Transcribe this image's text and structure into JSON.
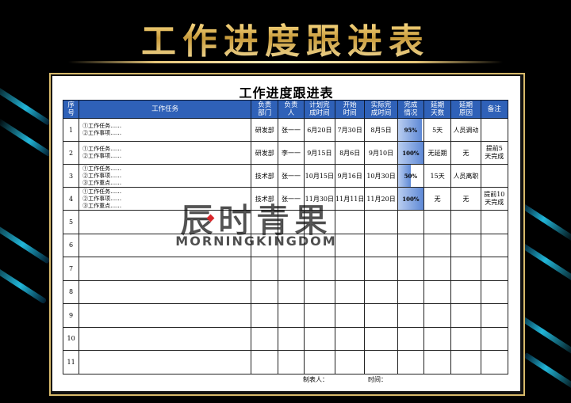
{
  "banner": {
    "title": "工作进度跟进表"
  },
  "sheet": {
    "title": "工作进度跟进表",
    "headers": {
      "no": [
        "序",
        "号"
      ],
      "task": "工作任务",
      "dept": [
        "负责",
        "部门"
      ],
      "person": [
        "负责",
        "人"
      ],
      "plan": [
        "计划完",
        "成时间"
      ],
      "start": [
        "开始",
        "时间"
      ],
      "actual": [
        "实际完",
        "成时间"
      ],
      "progress": [
        "完成",
        "情况"
      ],
      "delay_days": [
        "延期",
        "天数"
      ],
      "delay_reason": [
        "延期",
        "原因"
      ],
      "remark": "备注"
    },
    "rows": [
      {
        "no": "1",
        "tasks": [
          "①工作任务……",
          "②工作事项……"
        ],
        "dept": "研发部",
        "person": "张一一",
        "plan": "6月20日",
        "start": "7月30日",
        "actual": "8月5日",
        "progress": "95%",
        "progress_value": 0.95,
        "delay_days": "5天",
        "delay_reason": "人员调动",
        "remark": [
          "",
          ""
        ]
      },
      {
        "no": "2",
        "tasks": [
          "①工作任务……",
          "②工作事项……"
        ],
        "dept": "研发部",
        "person": "李一一",
        "plan": "9月15日",
        "start": "8月6日",
        "actual": "9月10日",
        "progress": "100%",
        "progress_value": 1.0,
        "delay_days": "无延期",
        "delay_reason": "无",
        "remark": [
          "提前5",
          "天完成"
        ]
      },
      {
        "no": "3",
        "tasks": [
          "①工作任务……",
          "②工作事项……",
          "③工作重点……"
        ],
        "dept": "技术部",
        "person": "张一一",
        "plan": "10月15日",
        "start": "9月16日",
        "actual": "10月30日",
        "progress": "50%",
        "progress_value": 0.5,
        "delay_days": "15天",
        "delay_reason": "人员离职",
        "remark": [
          "",
          ""
        ]
      },
      {
        "no": "4",
        "tasks": [
          "①工作任务……",
          "②工作事项……",
          "③工作重点……"
        ],
        "dept": "技术部",
        "person": "张一一",
        "plan": "11月30日",
        "start": "11月11日",
        "actual": "11月20日",
        "progress": "100%",
        "progress_value": 1.0,
        "delay_days": "无",
        "delay_reason": "无",
        "remark": [
          "提前10",
          "天完成"
        ]
      }
    ],
    "blank_rows": [
      "5",
      "6",
      "7",
      "8",
      "9",
      "10",
      "11"
    ],
    "footer": {
      "maker": "制表人：",
      "time": "时间："
    }
  },
  "watermark": {
    "cn": "辰时青果",
    "en": "MORNINGKINGDOM"
  },
  "colors": {
    "header_blue": "#2f61b8",
    "gold": "#e4c478",
    "stripe": "#27d6ff"
  }
}
